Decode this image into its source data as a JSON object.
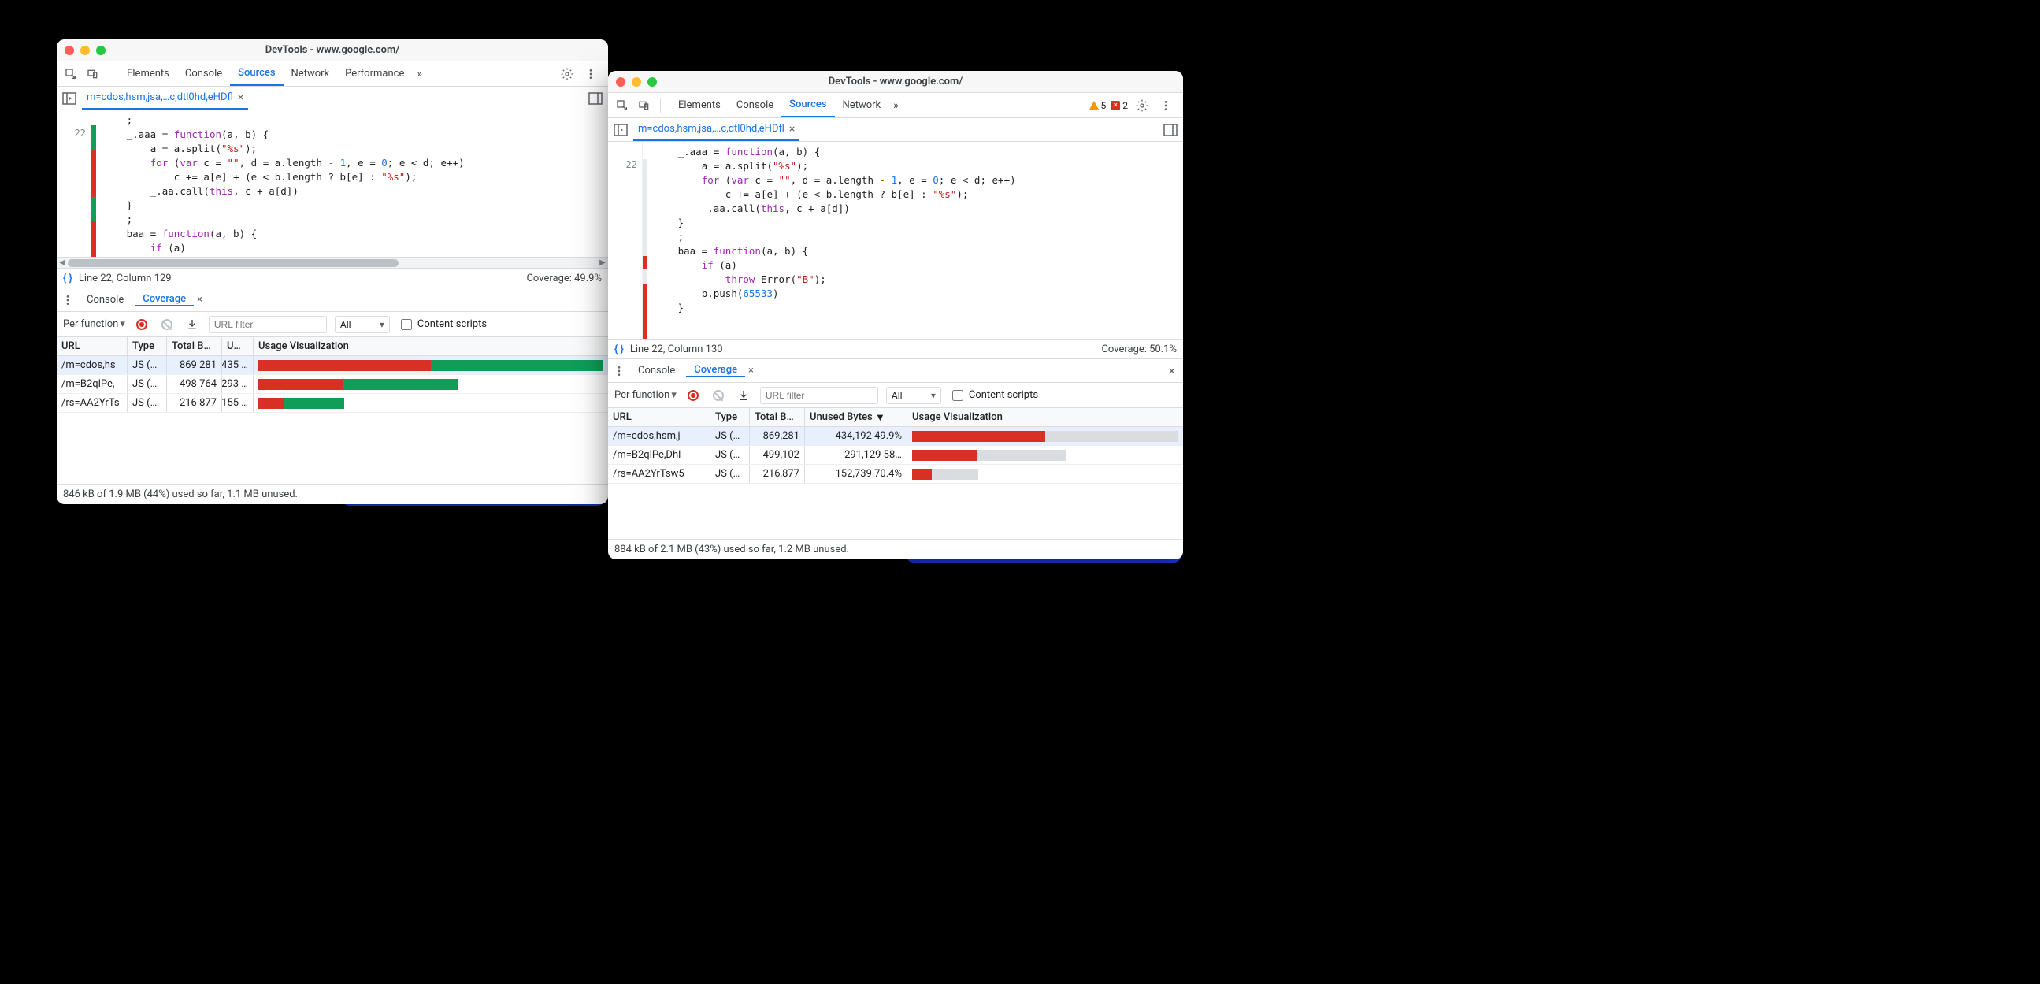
{
  "left": {
    "title": "DevTools - www.google.com/",
    "topTabs": {
      "elements": "Elements",
      "console": "Console",
      "sources": "Sources",
      "network": "Network",
      "performance": "Performance"
    },
    "fileTab": "m=cdos,hsm,jsa,…c,dtl0hd,eHDfl",
    "lineNumber": "22",
    "status": "Line 22, Column 129",
    "coverageLabel": "Coverage: 49.9%",
    "drawer": {
      "console": "Console",
      "coverage": "Coverage"
    },
    "perFunction": "Per function",
    "urlFilterPlaceholder": "URL filter",
    "allLabel": "All",
    "contentScripts": "Content scripts",
    "columns": {
      "url": "URL",
      "type": "Type",
      "total": "Total B…",
      "unused": "U…",
      "viz": "Usage Visualization"
    },
    "rows": [
      {
        "url": "/m=cdos,hs",
        "type": "JS (…",
        "total": "869 281",
        "unused": "435 …",
        "usedPct": 50,
        "widthPct": 100,
        "sel": true
      },
      {
        "url": "/m=B2qlPe,",
        "type": "JS (…",
        "total": "498 764",
        "unused": "293 …",
        "usedPct": 42,
        "widthPct": 58,
        "sel": false
      },
      {
        "url": "/rs=AA2YrTs",
        "type": "JS (…",
        "total": "216 877",
        "unused": "155 …",
        "usedPct": 30,
        "widthPct": 25,
        "sel": false
      }
    ],
    "footer": "846 kB of 1.9 MB (44%) used so far, 1.1 MB unused."
  },
  "right": {
    "title": "DevTools - www.google.com/",
    "issues": {
      "warnCount": "5",
      "errCount": "2"
    },
    "topTabs": {
      "elements": "Elements",
      "console": "Console",
      "sources": "Sources",
      "network": "Network"
    },
    "fileTab": "m=cdos,hsm,jsa,…c,dtl0hd,eHDfl",
    "lineNumber": "22",
    "status": "Line 22, Column 130",
    "coverageLabel": "Coverage: 50.1%",
    "drawer": {
      "console": "Console",
      "coverage": "Coverage"
    },
    "perFunction": "Per function",
    "urlFilterPlaceholder": "URL filter",
    "allLabel": "All",
    "contentScripts": "Content scripts",
    "columns": {
      "url": "URL",
      "type": "Type",
      "total": "Total B…",
      "unused": "Unused Bytes",
      "viz": "Usage Visualization"
    },
    "sortIndicator": "▼",
    "rows": [
      {
        "url": "/m=cdos,hsm,j",
        "type": "JS (…",
        "total": "869,281",
        "unused": "434,192",
        "pct": "49.9%",
        "usedPct": 50,
        "widthPct": 100,
        "sel": true
      },
      {
        "url": "/m=B2qlPe,Dhl",
        "type": "JS (…",
        "total": "499,102",
        "unused": "291,129",
        "pct": "58…",
        "usedPct": 42,
        "widthPct": 58,
        "sel": false
      },
      {
        "url": "/rs=AA2YrTsw5",
        "type": "JS (…",
        "total": "216,877",
        "unused": "152,739",
        "pct": "70.4%",
        "usedPct": 30,
        "widthPct": 25,
        "sel": false
      }
    ],
    "footer": "884 kB of 2.1 MB (43%) used so far, 1.2 MB unused."
  },
  "code": {
    "l1": ";",
    "l2_a": "_.aaa = ",
    "l2_fn": "function",
    "l2_b": "(a, b) {",
    "l3_a": "a = a.split(",
    "l3_s": "\"%s\"",
    "l3_b": ");",
    "l4_a": "for",
    "l4_b": " (",
    "l4_c": "var",
    "l4_d": " c = ",
    "l4_e": "\"\"",
    "l4_f": ", d = a.length ",
    "l4_g": "-",
    "l4_h": " ",
    "l4_i": "1",
    "l4_j": ", e = ",
    "l4_k": "0",
    "l4_l": "; e < d; e++)",
    "l5_a": "c += a[e] + (e < b.length ? b[e] : ",
    "l5_s": "\"%s\"",
    "l5_b": ");",
    "l6_a": "_.aa.call(",
    "l6_t": "this",
    "l6_b": ", c + a[d])",
    "l7": "}",
    "l8": ";",
    "l9_a": "baa = ",
    "l9_fn": "function",
    "l9_b": "(a, b) {",
    "l10_a": "if",
    "l10_b": " (a)",
    "l11_a": "throw",
    "l11_b": " Error(",
    "l11_s": "\"B\"",
    "l11_c": ");",
    "l12_a": "b.push(",
    "l12_n": "65533",
    "l12_b": ")",
    "l13": "}"
  }
}
